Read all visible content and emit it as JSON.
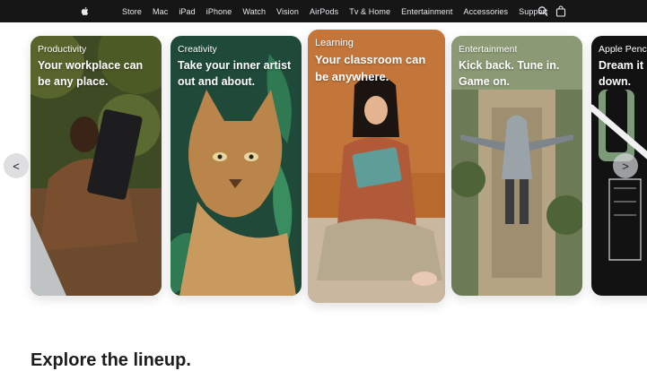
{
  "nav": {
    "logo_icon": "apple-logo-icon",
    "items": [
      "Store",
      "Mac",
      "iPad",
      "iPhone",
      "Watch",
      "Vision",
      "AirPods",
      "Tv & Home",
      "Entertainment",
      "Accessories",
      "Support"
    ],
    "search_icon": "search-icon",
    "bag_icon": "bag-icon"
  },
  "carousel": {
    "prev_label": "<",
    "next_label": ">",
    "cards": [
      {
        "eyebrow": "Productivity",
        "headline": "Your workplace can be any place."
      },
      {
        "eyebrow": "Creativity",
        "headline": "Take your inner artist out and about."
      },
      {
        "eyebrow": "Learning",
        "headline": "Your classroom can be anywhere."
      },
      {
        "eyebrow": "Entertainment",
        "headline": "Kick back. Tune in. Game on."
      },
      {
        "eyebrow": "Apple Pencil",
        "headline": "Dream it up. Jot it down."
      }
    ]
  },
  "section": {
    "title": "Explore the lineup."
  },
  "colors": {
    "nav_bg": "#161617",
    "nav_text": "#e8e8ed",
    "headline_text": "#1d1d1f"
  }
}
